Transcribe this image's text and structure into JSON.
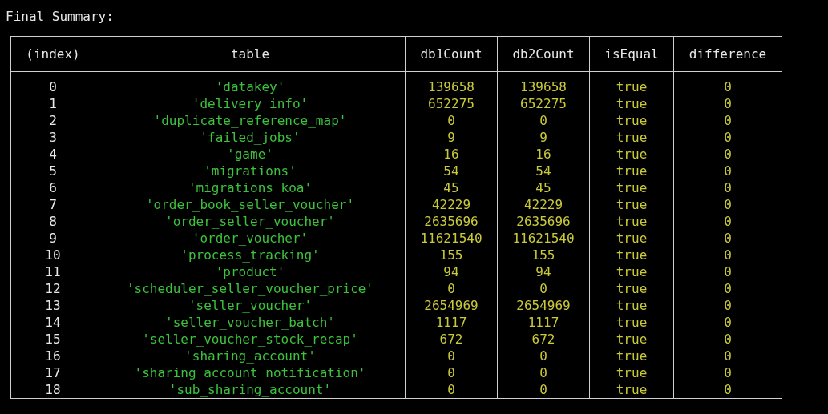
{
  "heading": "Final Summary:",
  "columns": [
    {
      "label": "(index)",
      "kind": "index"
    },
    {
      "label": "table",
      "kind": "string"
    },
    {
      "label": "db1Count",
      "kind": "number"
    },
    {
      "label": "db2Count",
      "kind": "number"
    },
    {
      "label": "isEqual",
      "kind": "boolean"
    },
    {
      "label": "difference",
      "kind": "number"
    }
  ],
  "rows": [
    [
      "0",
      "'datakey'",
      "139658",
      "139658",
      "true",
      "0"
    ],
    [
      "1",
      "'delivery_info'",
      "652275",
      "652275",
      "true",
      "0"
    ],
    [
      "2",
      "'duplicate_reference_map'",
      "0",
      "0",
      "true",
      "0"
    ],
    [
      "3",
      "'failed_jobs'",
      "9",
      "9",
      "true",
      "0"
    ],
    [
      "4",
      "'game'",
      "16",
      "16",
      "true",
      "0"
    ],
    [
      "5",
      "'migrations'",
      "54",
      "54",
      "true",
      "0"
    ],
    [
      "6",
      "'migrations_koa'",
      "45",
      "45",
      "true",
      "0"
    ],
    [
      "7",
      "'order_book_seller_voucher'",
      "42229",
      "42229",
      "true",
      "0"
    ],
    [
      "8",
      "'order_seller_voucher'",
      "2635696",
      "2635696",
      "true",
      "0"
    ],
    [
      "9",
      "'order_voucher'",
      "11621540",
      "11621540",
      "true",
      "0"
    ],
    [
      "10",
      "'process_tracking'",
      "155",
      "155",
      "true",
      "0"
    ],
    [
      "11",
      "'product'",
      "94",
      "94",
      "true",
      "0"
    ],
    [
      "12",
      "'scheduler_seller_voucher_price'",
      "0",
      "0",
      "true",
      "0"
    ],
    [
      "13",
      "'seller_voucher'",
      "2654969",
      "2654969",
      "true",
      "0"
    ],
    [
      "14",
      "'seller_voucher_batch'",
      "1117",
      "1117",
      "true",
      "0"
    ],
    [
      "15",
      "'seller_voucher_stock_recap'",
      "672",
      "672",
      "true",
      "0"
    ],
    [
      "16",
      "'sharing_account'",
      "0",
      "0",
      "true",
      "0"
    ],
    [
      "17",
      "'sharing_account_notification'",
      "0",
      "0",
      "true",
      "0"
    ],
    [
      "18",
      "'sub_sharing_account'",
      "0",
      "0",
      "true",
      "0"
    ]
  ]
}
